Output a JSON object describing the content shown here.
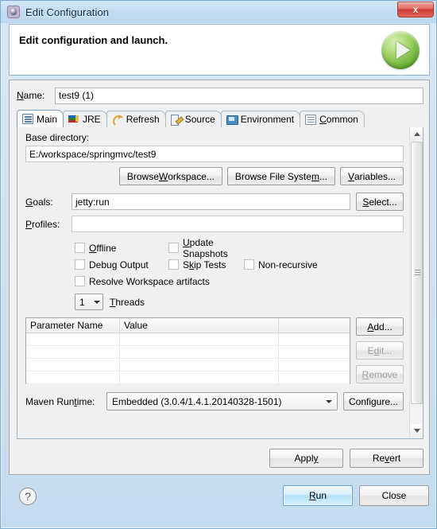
{
  "window": {
    "title": "Edit Configuration",
    "title_icon": "launch-config-icon",
    "close_label": "x"
  },
  "header": {
    "title": "Edit configuration and launch.",
    "badge_icon": "run-play-icon"
  },
  "name_row": {
    "label": "Name:",
    "mnemonic": "N",
    "value": "test9 (1)"
  },
  "tabs": [
    {
      "label": "Main",
      "icon": "main-document-icon",
      "active": true
    },
    {
      "label": "JRE",
      "icon": "jre-books-icon",
      "active": false
    },
    {
      "label": "Refresh",
      "icon": "refresh-arrows-icon",
      "active": false
    },
    {
      "label": "Source",
      "icon": "source-pencil-icon",
      "active": false
    },
    {
      "label": "Environment",
      "icon": "environment-monitor-icon",
      "active": false
    },
    {
      "label": "Common",
      "icon": "common-list-icon",
      "active": false
    }
  ],
  "main": {
    "base_directory": {
      "label": "Base directory:",
      "value": "E:/workspace/springmvc/test9",
      "buttons": [
        {
          "label": "Browse Workspace...",
          "name": "browse-workspace-button"
        },
        {
          "label": "Browse File System...",
          "name": "browse-file-system-button"
        },
        {
          "label": "Variables...",
          "name": "variables-button"
        }
      ]
    },
    "goals": {
      "label": "Goals:",
      "value": "jetty:run",
      "select_button": "Select..."
    },
    "profiles": {
      "label": "Profiles:",
      "value": ""
    },
    "checkboxes": [
      {
        "label": "Offline",
        "checked": false
      },
      {
        "label": "Update Snapshots",
        "checked": false
      },
      {
        "label": "Debug Output",
        "checked": false
      },
      {
        "label": "Skip Tests",
        "checked": false
      },
      {
        "label": "Non-recursive",
        "checked": false
      },
      {
        "label": "Resolve Workspace artifacts",
        "checked": false
      }
    ],
    "threads": {
      "value": "1",
      "label": "Threads"
    },
    "parameter_table": {
      "columns": [
        "Parameter Name",
        "Value",
        ""
      ],
      "rows": [],
      "empty_row_count": 4,
      "buttons": [
        {
          "label": "Add...",
          "enabled": true
        },
        {
          "label": "Edit...",
          "enabled": false
        },
        {
          "label": "Remove",
          "enabled": false
        }
      ]
    },
    "maven_runtime": {
      "label": "Maven Runtime:",
      "value": "Embedded (3.0.4/1.4.1.20140328-1501)",
      "configure_button": "Configure..."
    }
  },
  "apply_row": {
    "apply": "Apply",
    "revert": "Revert"
  },
  "bottom": {
    "help_icon": "help-question-icon",
    "run": "Run",
    "close": "Close"
  },
  "colors": {
    "title_bar": "#c9e0f4",
    "close_red": "#cf3a31",
    "run_green": "#62ab2e",
    "primary_button": "#b3e0f7",
    "panel": "#f0f0f0"
  }
}
